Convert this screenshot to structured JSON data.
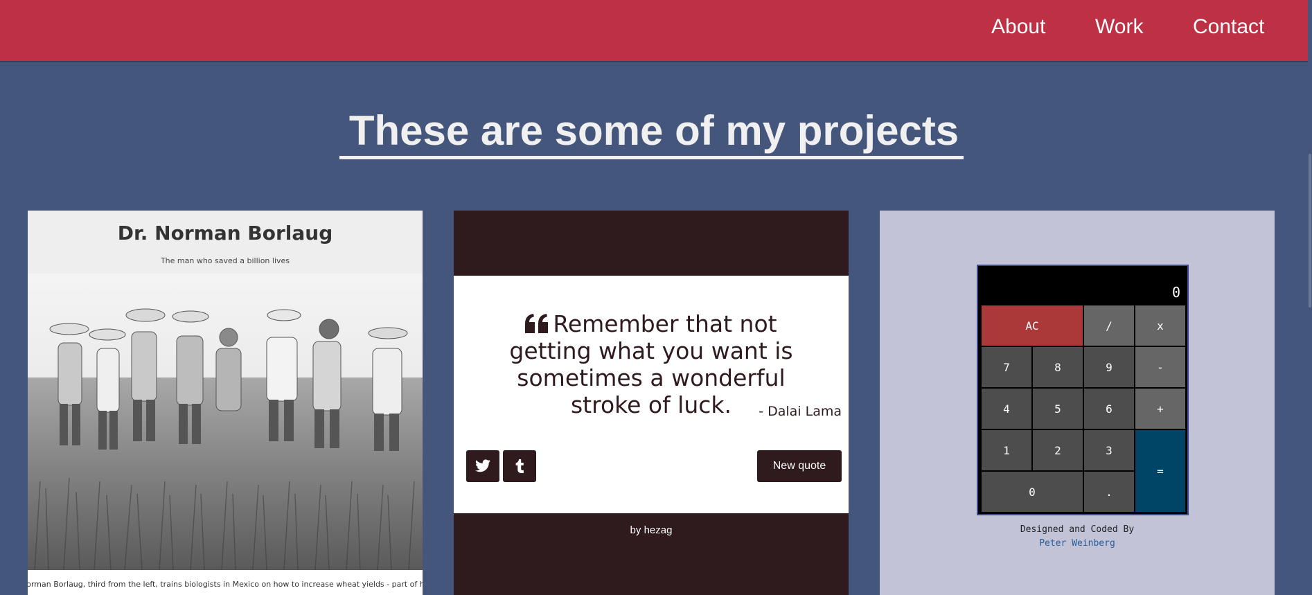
{
  "nav": {
    "about": "About",
    "work": "Work",
    "contact": "Contact"
  },
  "heading": "These are some of my projects",
  "colors": {
    "nav_bg": "#be3144",
    "page_bg": "#45567d",
    "quote_bg": "#2f1b1e",
    "calc_bg": "#c3c3d7"
  },
  "tribute": {
    "title": "Dr. Norman Borlaug",
    "subtitle": "The man who saved a billion lives",
    "image_icon": "photo-wheat-field",
    "caption": "Norman Borlaug, third from the left, trains biologists in Mexico on how to increase wheat yields - part of his life-long war on hunger."
  },
  "quote": {
    "icon": "quote-left-icon",
    "text": "Remember that not getting what you want is sometimes a wonderful stroke of luck.",
    "author": "- Dalai Lama",
    "twitter_icon": "twitter-icon",
    "tumblr_icon": "tumblr-icon",
    "new_quote": "New quote",
    "byline_prefix": "by",
    "byline_name": "hezag"
  },
  "calculator": {
    "display": "0",
    "keys": {
      "ac": "AC",
      "divide": "/",
      "multiply": "x",
      "seven": "7",
      "eight": "8",
      "nine": "9",
      "subtract": "-",
      "four": "4",
      "five": "5",
      "six": "6",
      "add": "+",
      "one": "1",
      "two": "2",
      "three": "3",
      "equals": "=",
      "zero": "0",
      "decimal": "."
    },
    "credit": "Designed and Coded By",
    "author": "Peter Weinberg"
  }
}
